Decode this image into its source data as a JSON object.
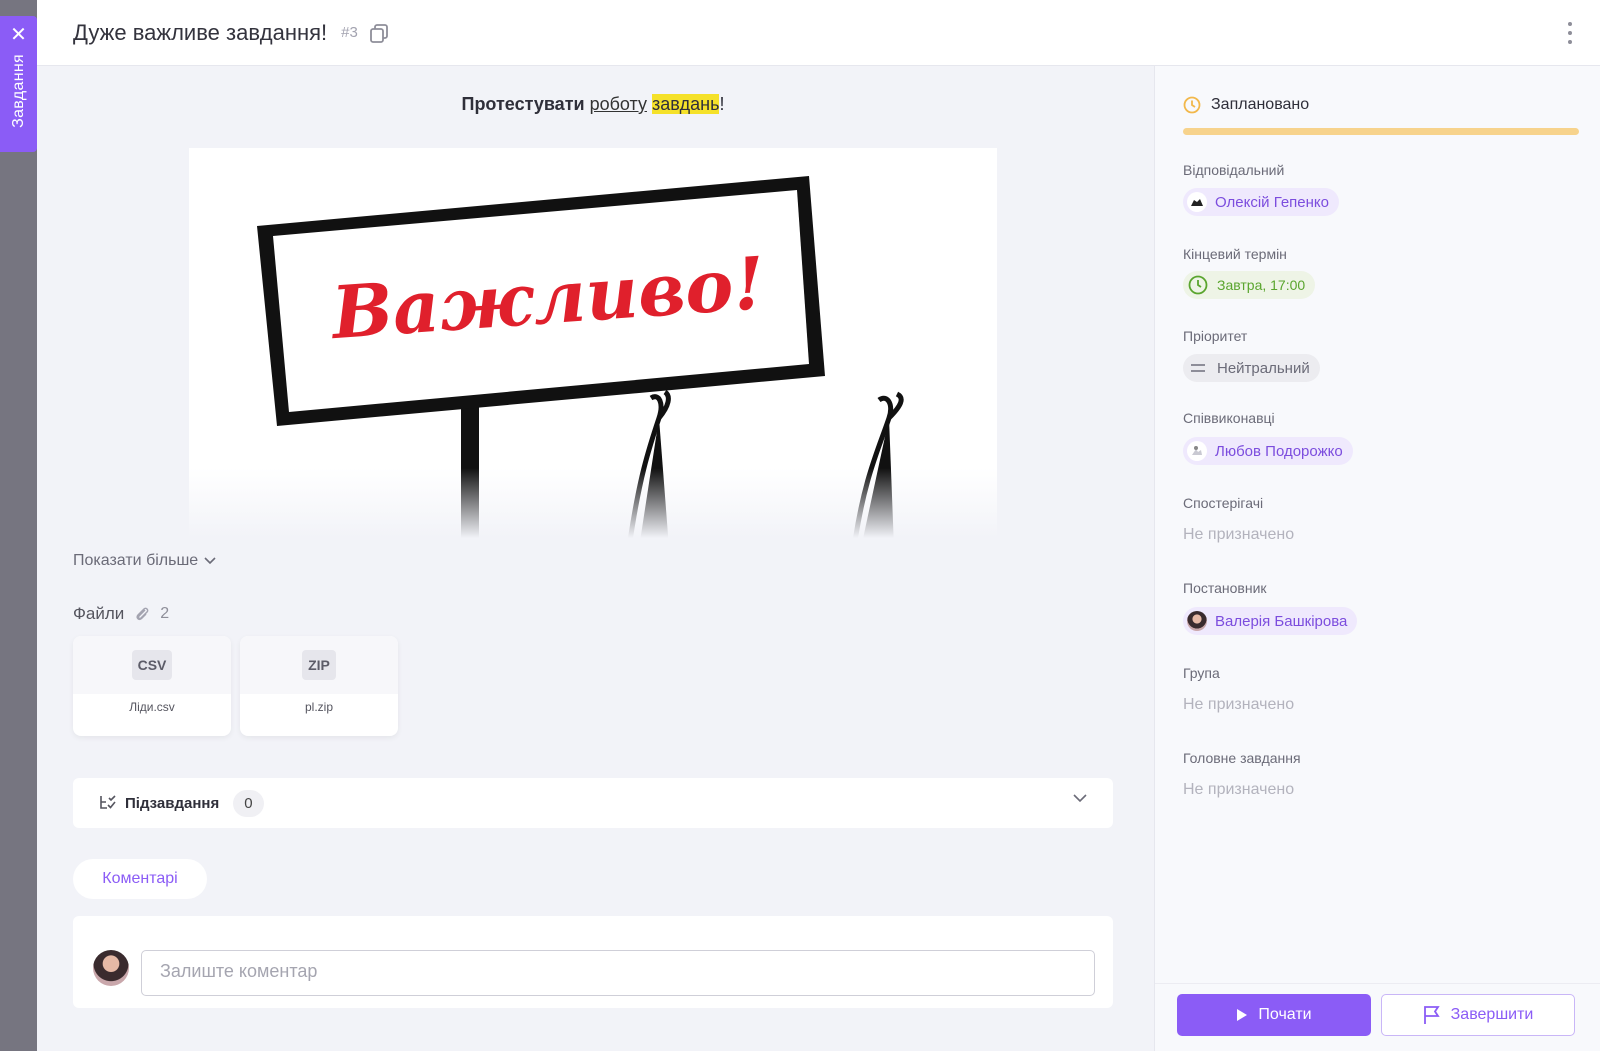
{
  "side_tab": {
    "label": "Завдання",
    "close_icon": "close-icon"
  },
  "header": {
    "title": "Дуже важливе завдання!",
    "task_number": "#3",
    "copy_icon": "copy-icon",
    "more_icon": "more-vertical-icon"
  },
  "content": {
    "lead": {
      "bold": "Протестувати",
      "link": "роботу",
      "highlight": "завдань",
      "tail": "!"
    },
    "image": {
      "sign_text": "Важливо!",
      "sign_color": "#e0202c"
    },
    "show_more": "Показати більше",
    "files": {
      "label": "Файли",
      "count": "2",
      "items": [
        {
          "ext": "CSV",
          "name": "Ліди.csv"
        },
        {
          "ext": "ZIP",
          "name": "pl.zip"
        }
      ]
    },
    "subtasks": {
      "label": "Підзавдання",
      "count": "0"
    },
    "comments": {
      "tab_label": "Коментарі",
      "placeholder": "Залиште коментар"
    }
  },
  "sidebar": {
    "status": {
      "label": "Заплановано",
      "color": "#f7d38c"
    },
    "assignee": {
      "label": "Відповідальний",
      "value": "Олексій Гепенко"
    },
    "deadline": {
      "label": "Кінцевий термін",
      "value": "Завтра, 17:00",
      "color": "#5aa52e"
    },
    "priority": {
      "label": "Пріоритет",
      "value": "Нейтральний"
    },
    "coexecutors": {
      "label": "Співвиконавці",
      "value": "Любов Подорожко"
    },
    "observers": {
      "label": "Спостерігачі",
      "value": "Не призначено"
    },
    "author": {
      "label": "Постановник",
      "value": "Валерія Башкірова"
    },
    "group": {
      "label": "Група",
      "value": "Не призначено"
    },
    "parent_task": {
      "label": "Головне завдання",
      "value": "Не призначено"
    },
    "buttons": {
      "start": "Почати",
      "finish": "Завершити"
    }
  },
  "colors": {
    "accent": "#8b5cf6",
    "background": "#f2f3f8"
  }
}
